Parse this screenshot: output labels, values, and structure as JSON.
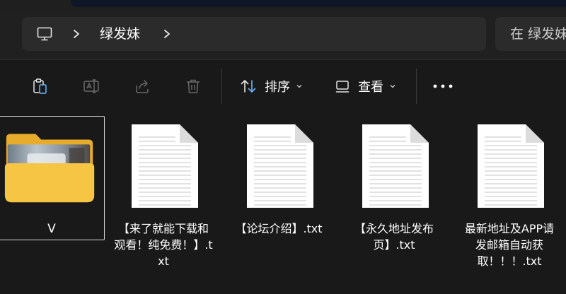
{
  "breadcrumb": {
    "current_folder": "绿发妹"
  },
  "search": {
    "placeholder": "在 绿发妹"
  },
  "toolbar": {
    "sort_label": "排序",
    "view_label": "查看"
  },
  "colors": {
    "background": "#191919",
    "bar": "#202020",
    "field": "#2b2b2b",
    "folder": "#f5c543"
  },
  "items": [
    {
      "name": "V",
      "kind": "folder",
      "selected": true
    },
    {
      "name": "【来了就能下载和观看！纯免费！】.txt",
      "kind": "text-file"
    },
    {
      "name": "【论坛介绍】.txt",
      "kind": "text-file"
    },
    {
      "name": "【永久地址发布页】.txt",
      "kind": "text-file"
    },
    {
      "name": "最新地址及APP请发邮箱自动获取！！！.txt",
      "kind": "text-file"
    }
  ]
}
